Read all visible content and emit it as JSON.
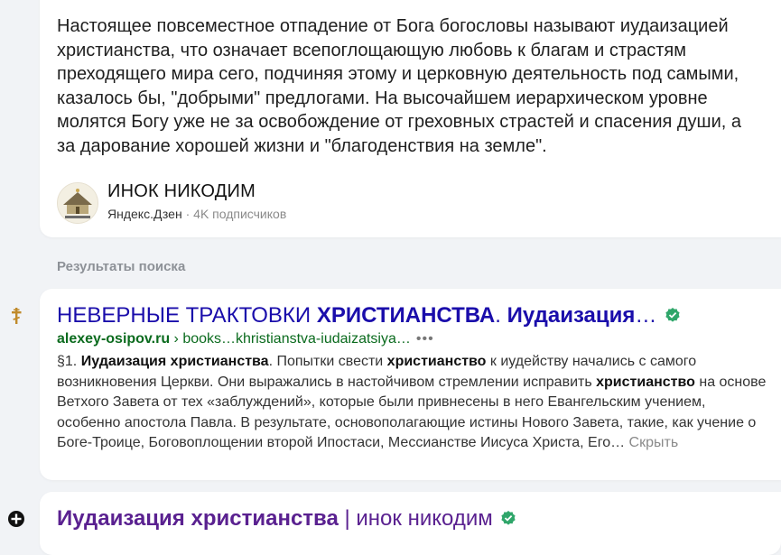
{
  "top_card": {
    "text": "Настоящее повсеместное отпадение от Бога богословы называют иудаизацией христианства, что означает всепоглощающую любовь к благам и страстям преходящего мира сего, подчиняя этому и церковную деятельность под самыми, казалось бы, \"добрыми\" предлогами. На высочайшем иерархическом уровне молятся Богу уже не за освобождение от греховных страстей и спасения души, а за дарование хорошей жизни и \"благоденствия на земле\".",
    "source_name": "ИНОК НИКОДИМ",
    "source_platform": "Яндекс.Дзен",
    "separator": "·",
    "subscribers": "4K подписчиков"
  },
  "results_label": "Результаты поиска",
  "results": [
    {
      "favicon": "orthodox-cross-icon",
      "title_plain": "НЕВЕРНЫЕ ТРАКТОВКИ ",
      "title_bold1": "ХРИСТИАНСТВА",
      "title_mid": ". ",
      "title_bold2": "Иудаизация",
      "title_ellipsis": "…",
      "verified": "verified-icon",
      "domain": "alexey-osipov.ru",
      "path": " › books…khristianstva-iudaizatsiya…",
      "more": "•••",
      "snippet": {
        "s1": "§1. ",
        "b1": "Иудаизация христианства",
        "s2": ". Попытки свести ",
        "b2": "христианство",
        "s3": " к иудейству начались с самого возникновения Церкви. Они выражались в настойчивом стремлении исправить ",
        "b3": "христианство",
        "s4": " на основе Ветхого Завета от тех «заблуждений», которые были привнесены в него Евангельским учением, особенно апостола Павла. В результате, основополагающие истины Нового Завета, такие, как учение о Боге-Троице, Боговоплощении второй Ипостаси, Мессианстве Иисуса Христа, Его…",
        "show_more": "Скрыть"
      }
    },
    {
      "favicon": "plus-circle-icon",
      "title_bold": "Иудаизация христианства",
      "title_rest": " | инок никодим",
      "verified": "verified-icon"
    }
  ],
  "colors": {
    "link": "#1a0dab",
    "visited": "#5a2190",
    "url_green": "#0b6b1e",
    "verified_green": "#2fa66a",
    "muted": "#8d9197"
  }
}
